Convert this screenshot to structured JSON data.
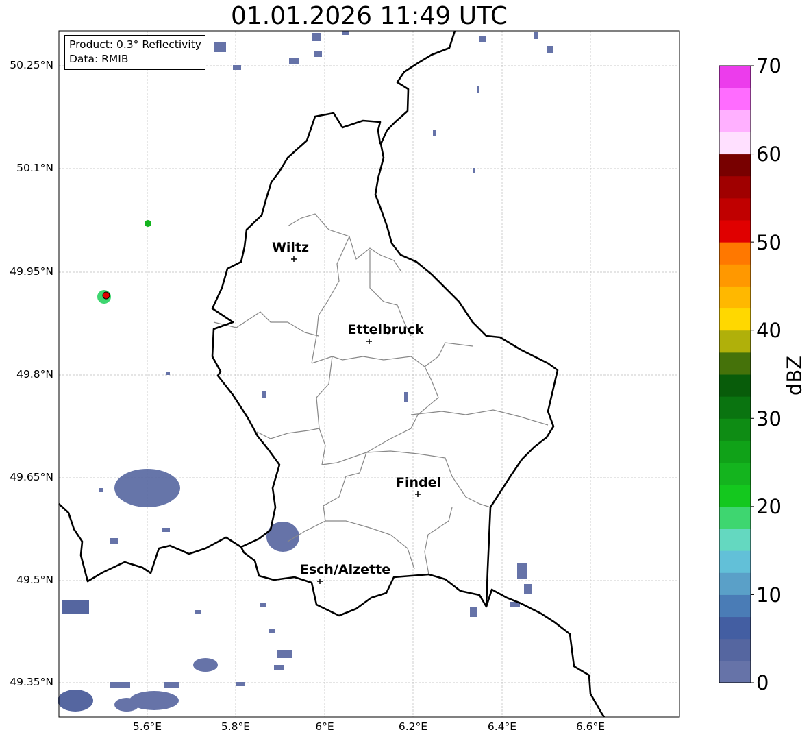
{
  "title": "01.01.2026 11:49 UTC",
  "info": {
    "product": "Product: 0.3° Reflectivity",
    "data": "Data: RMIB"
  },
  "lat_labels": [
    "50.25°N",
    "50.1°N",
    "49.95°N",
    "49.8°N",
    "49.65°N",
    "49.5°N",
    "49.35°N"
  ],
  "lon_labels": [
    "5.6°E",
    "5.8°E",
    "6°E",
    "6.2°E",
    "6.4°E",
    "6.6°E"
  ],
  "cities": [
    {
      "name": "Wiltz",
      "lon": 5.93,
      "lat": 49.97
    },
    {
      "name": "Ettelbruck",
      "lon": 6.1,
      "lat": 49.85
    },
    {
      "name": "Findel",
      "lon": 6.21,
      "lat": 49.63
    },
    {
      "name": "Esch/Alzette",
      "lon": 5.99,
      "lat": 49.5
    }
  ],
  "radar_site": {
    "lon": 5.505,
    "lat": 49.915
  },
  "colorbar": {
    "label": "dBZ",
    "ticks": [
      "0",
      "10",
      "20",
      "30",
      "40",
      "50",
      "60",
      "70"
    ],
    "colors": [
      "#6673a8",
      "#5566a0",
      "#435ea2",
      "#4a7cb6",
      "#5aa0c8",
      "#62c0d8",
      "#64d8c0",
      "#3ed670",
      "#14c81e",
      "#14b41e",
      "#10a218",
      "#0e8c14",
      "#0a7410",
      "#085c0a",
      "#45720a",
      "#b0b00a",
      "#ffd800",
      "#ffb800",
      "#ff9800",
      "#ff7800",
      "#e00000",
      "#c00000",
      "#a00000",
      "#780000",
      "#ffe0ff",
      "#ffb0ff",
      "#ff6cff",
      "#ec3cec"
    ]
  },
  "colors": {
    "border": "#000000",
    "cantons": "#888888",
    "grid": "#bbbbbb",
    "echo": "#6673a8"
  }
}
